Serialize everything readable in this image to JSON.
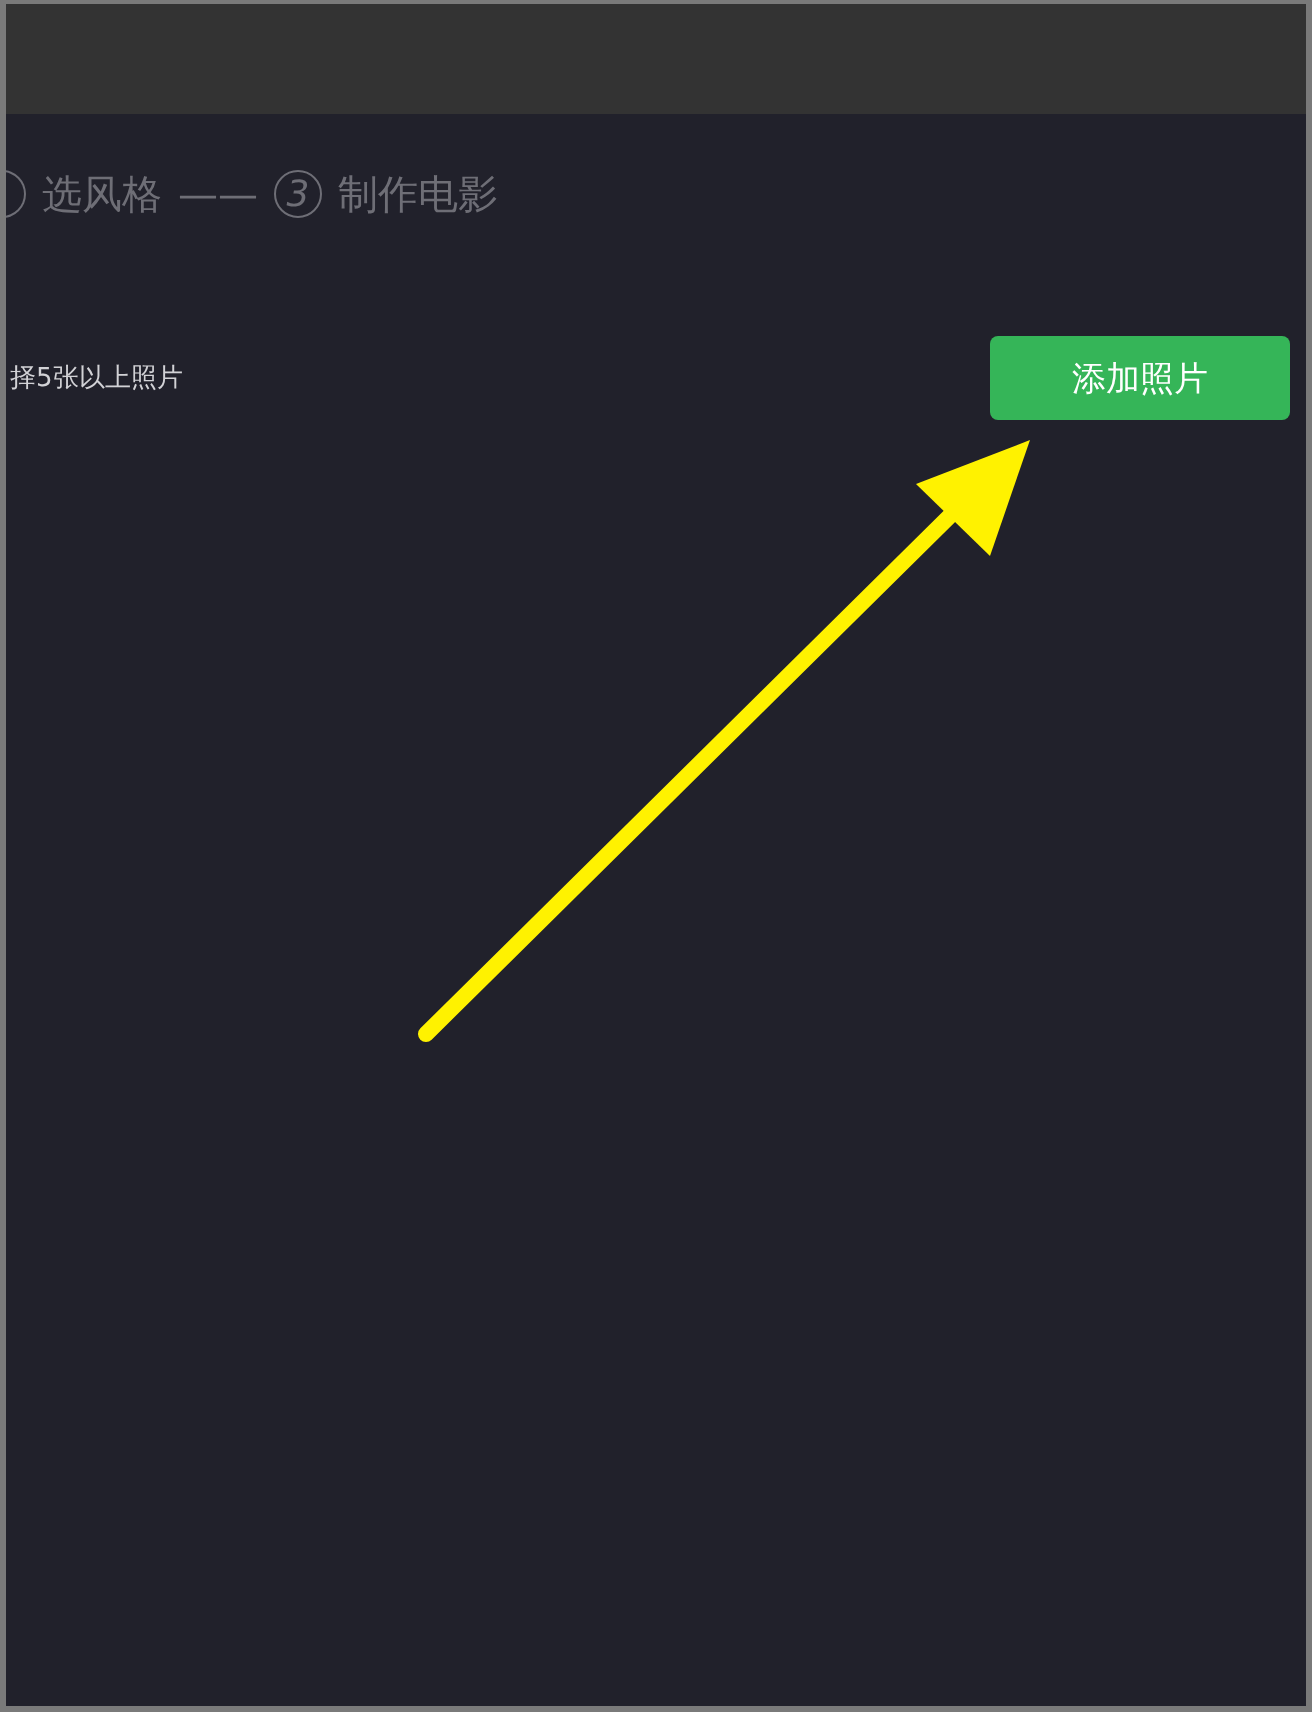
{
  "steps": [
    {
      "label": "选风格"
    },
    {
      "number": "3",
      "label": "制作电影"
    }
  ],
  "separator": "——",
  "hint": "择5张以上照片",
  "add_button": "添加照片"
}
